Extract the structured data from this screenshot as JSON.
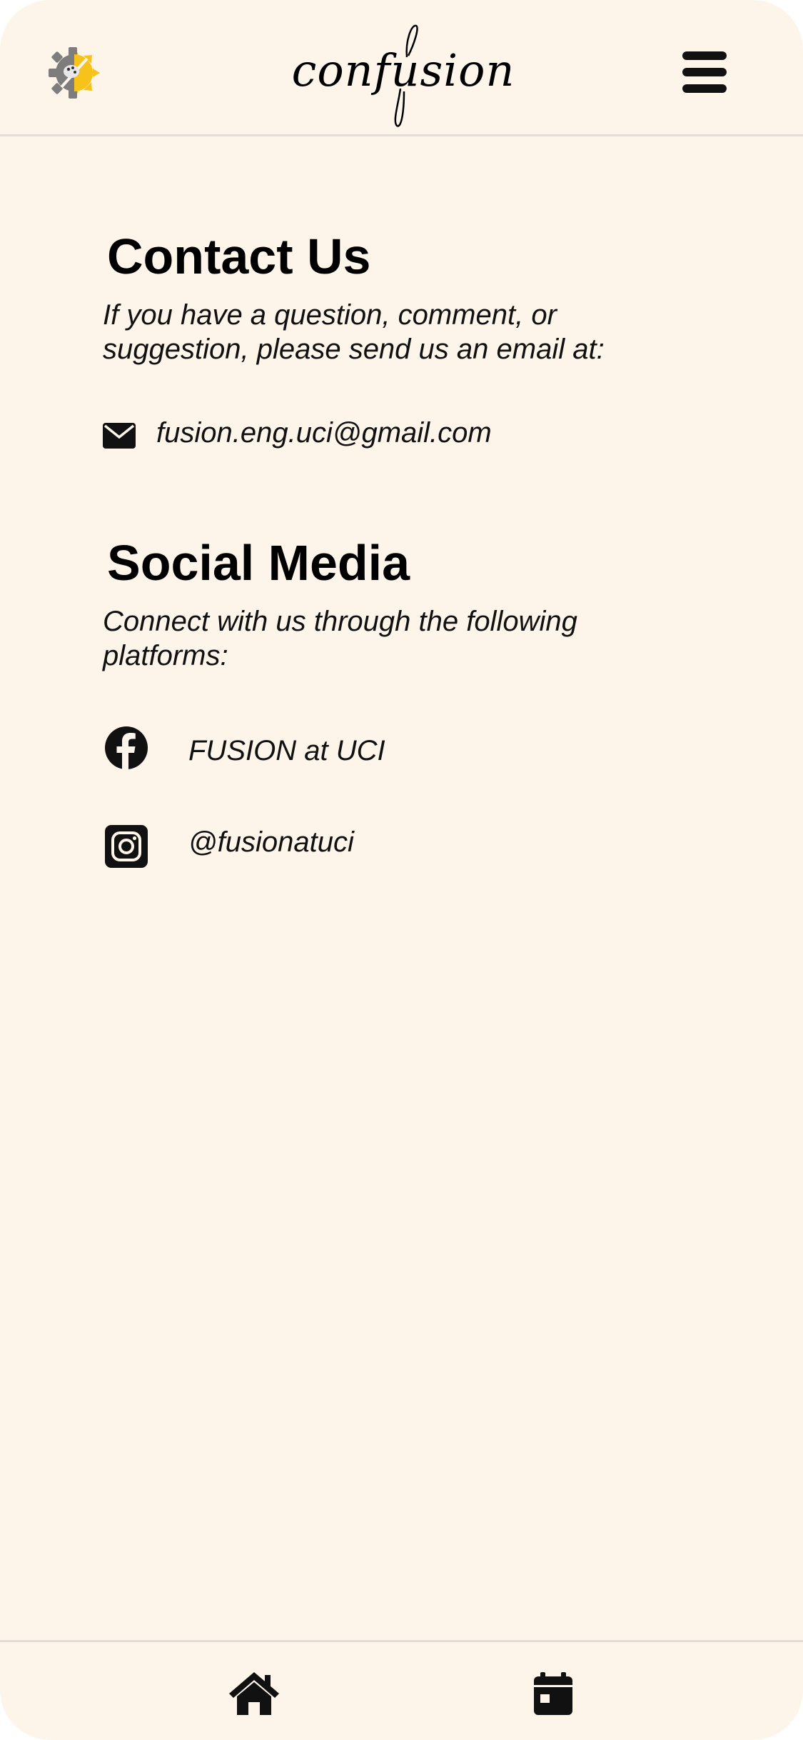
{
  "header": {
    "brand": "confusion"
  },
  "contact": {
    "title": "Contact Us",
    "description": "If you have a question, comment, or suggestion, please send us an email at:",
    "email": "fusion.eng.uci@gmail.com"
  },
  "social": {
    "title": "Social Media",
    "description": "Connect with us through the following platforms:",
    "facebook": "FUSION at UCI",
    "instagram": "@fusionatuci"
  },
  "icons": {
    "logo": "gear-sun-logo-icon",
    "menu": "hamburger-menu-icon",
    "email": "envelope-icon",
    "facebook": "facebook-icon",
    "instagram": "instagram-icon",
    "home": "home-icon",
    "calendar": "calendar-icon"
  },
  "colors": {
    "background": "#fdf5ea",
    "text": "#000000",
    "divider": "#e3ddd6",
    "logo_gear": "#7d7d7d",
    "logo_sun": "#f7c31b"
  }
}
